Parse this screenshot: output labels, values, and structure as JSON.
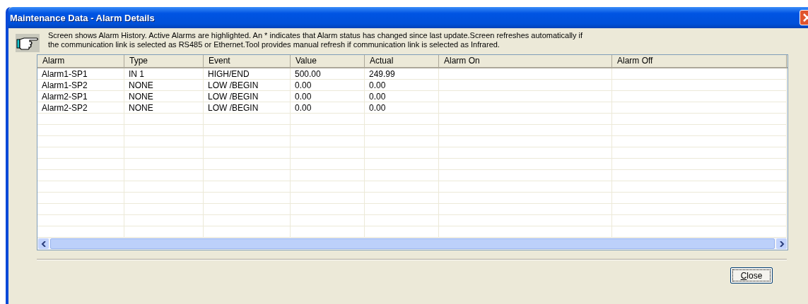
{
  "window": {
    "title": "Maintenance Data - Alarm Details"
  },
  "info": "Screen shows Alarm History.  Active Alarms are highlighted. An * indicates that Alarm status has changed since last update.Screen refreshes automatically if the communication link is selected as RS485 or Ethernet.Tool provides manual refresh if communication link is selected as Infrared.",
  "table": {
    "columns": [
      "Alarm",
      "Type",
      "Event",
      "Value",
      "Actual",
      "Alarm On",
      "Alarm Off"
    ],
    "rows": [
      [
        "Alarm1-SP1",
        "IN 1",
        "HIGH/END",
        "500.00",
        "249.99",
        "",
        ""
      ],
      [
        "Alarm1-SP2",
        "NONE",
        "LOW /BEGIN",
        "0.00",
        "0.00",
        "",
        ""
      ],
      [
        "Alarm2-SP1",
        "NONE",
        "LOW /BEGIN",
        "0.00",
        "0.00",
        "",
        ""
      ],
      [
        "Alarm2-SP2",
        "NONE",
        "LOW /BEGIN",
        "0.00",
        "0.00",
        "",
        ""
      ]
    ]
  },
  "buttons": [
    {
      "label": "Close"
    }
  ]
}
